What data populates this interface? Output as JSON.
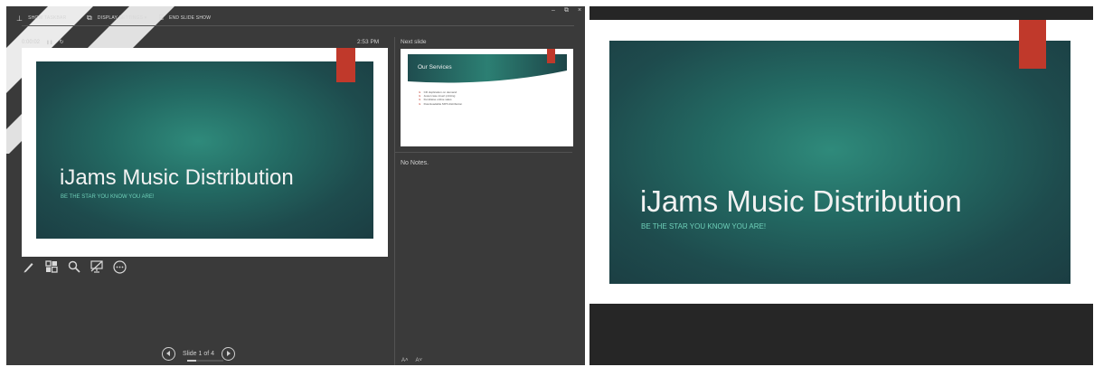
{
  "toolbar": {
    "show_taskbar": "SHOW TASKBAR",
    "display_settings": "DISPLAY SETTINGS ▾",
    "end_slide_show": "END SLIDE SHOW",
    "minimize": "–",
    "restore": "⧉",
    "close": "×"
  },
  "timer": {
    "elapsed": "0:00:02",
    "pause_glyph": "❚❚",
    "restart_glyph": "↻"
  },
  "clock": "2:53 PM",
  "current_slide": {
    "title": "iJams Music Distribution",
    "subtitle": "BE THE STAR YOU KNOW YOU ARE!"
  },
  "next_slide": {
    "label": "Next slide",
    "title": "Our Services",
    "bullets": [
      "CD duplication on demand",
      "Jewel case insert printing",
      "Fundraise online sales",
      "Downloadable MP3 distribution"
    ]
  },
  "notes": "No Notes.",
  "tools": [
    "pen-icon",
    "slide-grid-icon",
    "zoom-icon",
    "black-screen-icon",
    "more-options-icon"
  ],
  "navigation": {
    "counter": "Slide 1 of 4",
    "current": 1,
    "total": 4
  },
  "text_size": {
    "increase": "A˄",
    "decrease": "A˅"
  },
  "audience_slide": {
    "title": "iJams Music Distribution",
    "subtitle": "BE THE STAR YOU KNOW YOU ARE!"
  },
  "colors": {
    "accent_red": "#c0392b",
    "teal": "#236a63",
    "subtitle_teal": "#6ecfb8",
    "presenter_bg": "#3a3a3a"
  }
}
